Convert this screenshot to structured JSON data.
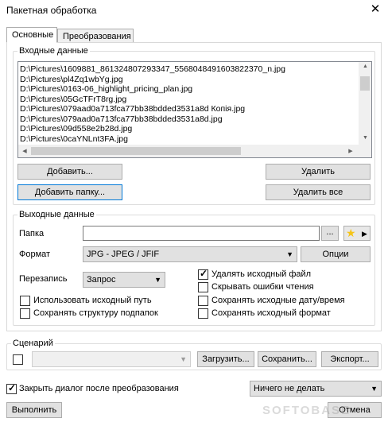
{
  "window": {
    "title": "Пакетная обработка"
  },
  "tabs": [
    {
      "label": "Основные"
    },
    {
      "label": "Преобразования"
    }
  ],
  "input_section": {
    "legend": "Входные данные",
    "files": [
      "D:\\Pictures\\1609881_861324807293347_5568048491603822370_n.jpg",
      "D:\\Pictures\\pl4Zq1wbYg.jpg",
      "D:\\Pictures\\0163-06_highlight_pricing_plan.jpg",
      "D:\\Pictures\\05GcTFrT8rg.jpg",
      "D:\\Pictures\\079aad0a713fca77bb38bdded3531a8d Копія.jpg",
      "D:\\Pictures\\079aad0a713fca77bb38bdded3531a8d.jpg",
      "D:\\Pictures\\09d558e2b28d.jpg",
      "D:\\Pictures\\0caYNLnt3FA.jpg"
    ],
    "add_label": "Добавить...",
    "add_folder_label": "Добавить папку...",
    "remove_label": "Удалить",
    "remove_all_label": "Удалить все"
  },
  "output_section": {
    "legend": "Выходные данные",
    "folder_label": "Папка",
    "folder_value": "",
    "browse_label": "...",
    "format_label": "Формат",
    "format_value": "JPG - JPEG / JFIF",
    "options_label": "Опции",
    "overwrite_label": "Перезапись",
    "overwrite_value": "Запрос",
    "checks": {
      "use_source_path": {
        "label": "Использовать исходный путь",
        "checked": false
      },
      "keep_subfolders": {
        "label": "Сохранять структуру подпапок",
        "checked": false
      },
      "delete_source": {
        "label": "Удалять исходный файл",
        "checked": true
      },
      "hide_read_errors": {
        "label": "Скрывать ошибки чтения",
        "checked": false
      },
      "keep_datetime": {
        "label": "Сохранять исходные дату/время",
        "checked": false
      },
      "keep_format": {
        "label": "Сохранять исходный формат",
        "checked": false
      }
    }
  },
  "scenario": {
    "legend": "Сценарий",
    "value": "",
    "load_label": "Загрузить...",
    "save_label": "Сохранить...",
    "export_label": "Экспорт..."
  },
  "footer": {
    "close_after_label": "Закрыть диалог после преобразования",
    "after_action_value": "Ничего не делать",
    "run_label": "Выполнить",
    "cancel_label": "Отмена",
    "watermark": "SOFTOBASE"
  },
  "colors": {
    "accent": "#0078d7",
    "star": "#f5c518"
  }
}
